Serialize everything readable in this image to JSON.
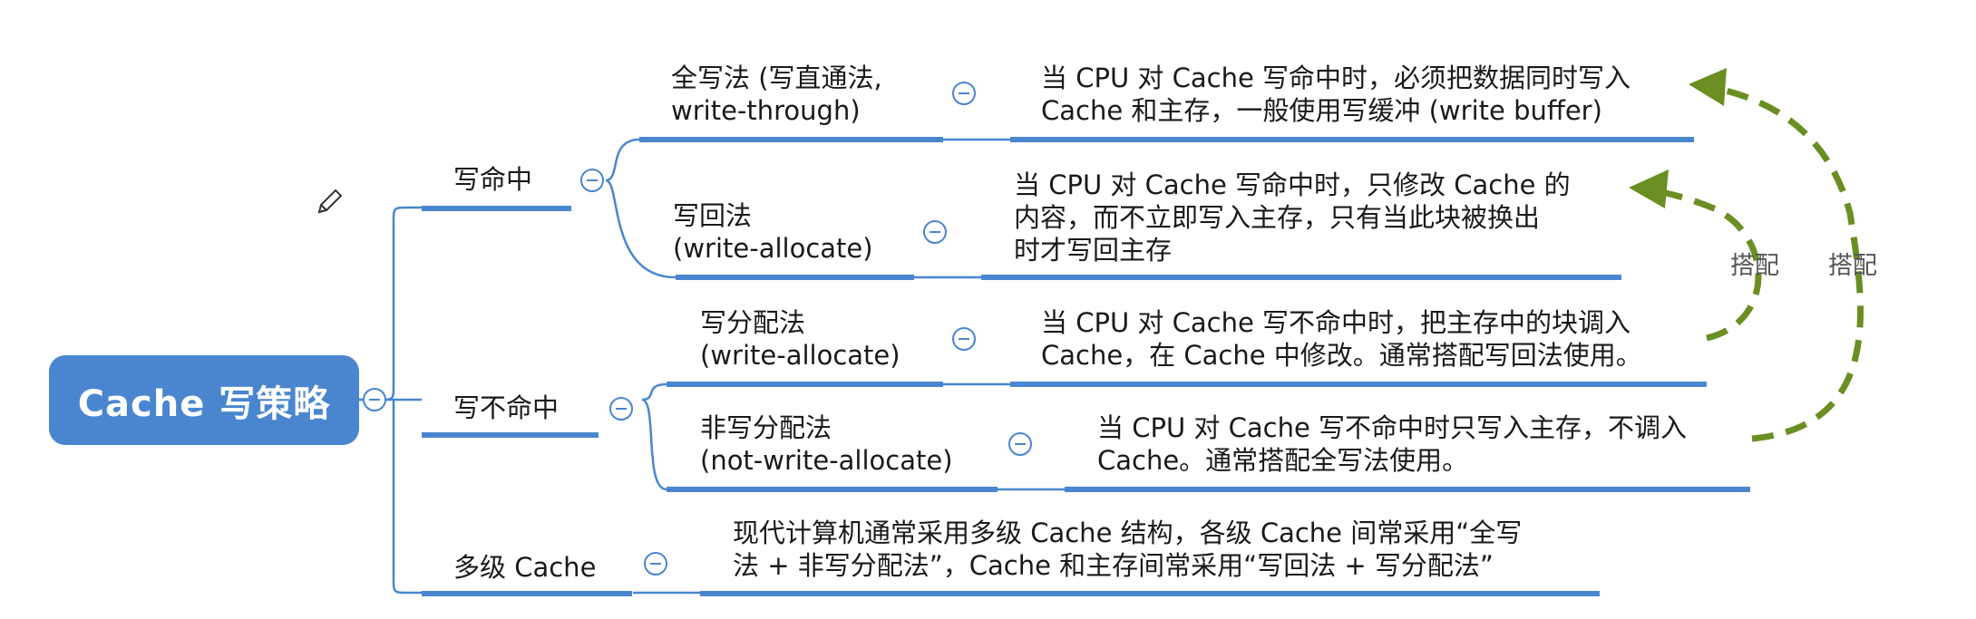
{
  "root": {
    "label": "Cache 写策略"
  },
  "branches": [
    {
      "label": "写命中",
      "children": [
        {
          "label": [
            "全写法 (写直通法,",
            "write-through)"
          ],
          "desc": [
            "当 CPU 对 Cache 写命中时，必须把数据同时写入",
            "Cache 和主存，一般使用写缓冲 (write buffer)"
          ]
        },
        {
          "label": [
            "写回法",
            "(write-allocate)"
          ],
          "desc": [
            "当 CPU 对 Cache 写命中时，只修改 Cache 的",
            "内容，而不立即写入主存，只有当此块被换出",
            "时才写回主存"
          ]
        }
      ]
    },
    {
      "label": "写不命中",
      "children": [
        {
          "label": [
            "写分配法",
            "(write-allocate)"
          ],
          "desc": [
            "当 CPU 对 Cache 写不命中时，把主存中的块调入",
            "Cache，在 Cache 中修改。通常搭配写回法使用。"
          ]
        },
        {
          "label": [
            "非写分配法",
            "(not-write-allocate)"
          ],
          "desc": [
            "当 CPU 对 Cache 写不命中时只写入主存，不调入",
            "Cache。通常搭配全写法使用。"
          ]
        }
      ]
    },
    {
      "label": "多级 Cache",
      "desc": [
        "现代计算机通常采用多级 Cache 结构，各级 Cache 间常采用“全写",
        "法 + 非写分配法”，Cache 和主存间常采用“写回法 + 写分配法”"
      ]
    }
  ],
  "relations": [
    {
      "label": "搭配",
      "from": "写分配法",
      "to": "写回法"
    },
    {
      "label": "搭配",
      "from": "非写分配法",
      "to": "全写法"
    }
  ],
  "colors": {
    "accent": "#4a86cf",
    "relation": "#6b8e23"
  },
  "icons": {
    "edit": "pencil-icon",
    "collapse": "collapse-icon"
  }
}
